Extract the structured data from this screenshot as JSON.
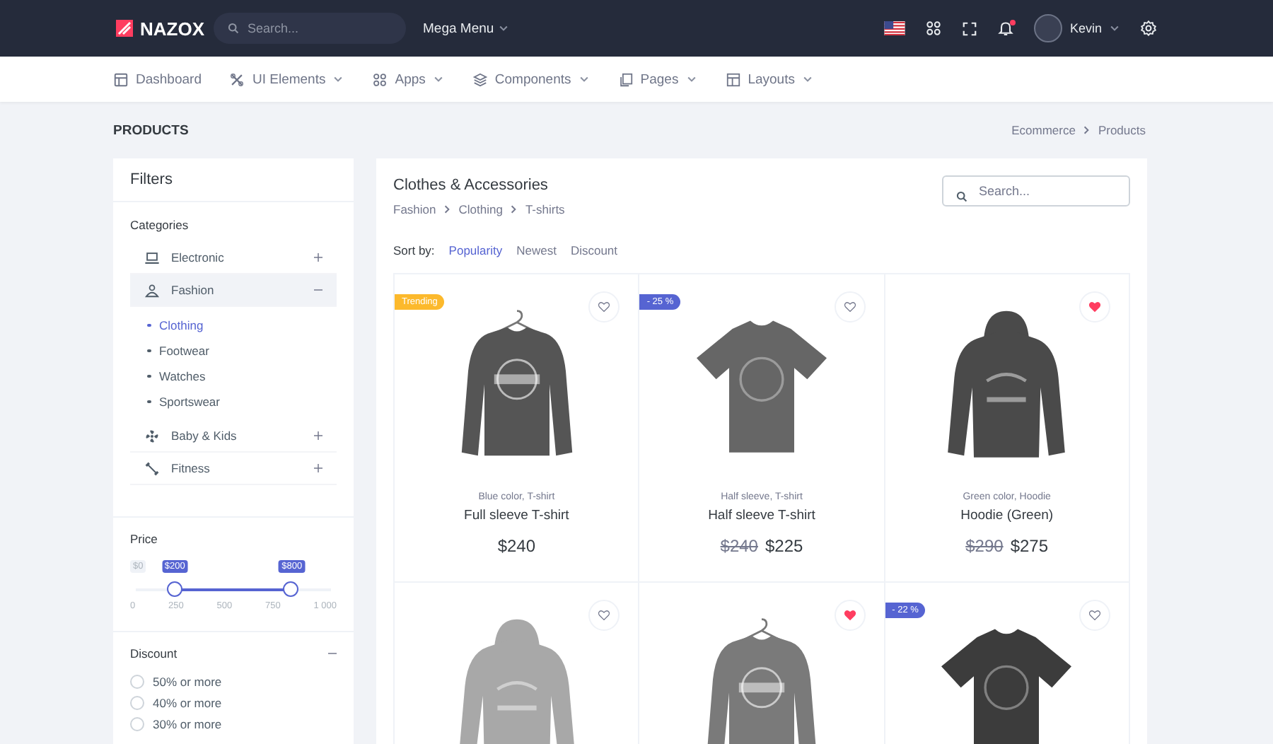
{
  "topbar": {
    "logo": "NAZOX",
    "search": {
      "placeholder": "Search..."
    },
    "mega_menu": "Mega Menu",
    "user": "Kevin"
  },
  "nav": [
    {
      "label": "Dashboard",
      "has_menu": false
    },
    {
      "label": "UI Elements",
      "has_menu": true
    },
    {
      "label": "Apps",
      "has_menu": true
    },
    {
      "label": "Components",
      "has_menu": true
    },
    {
      "label": "Pages",
      "has_menu": true
    },
    {
      "label": "Layouts",
      "has_menu": true
    }
  ],
  "page_title": "PRODUCTS",
  "breadcrumb": [
    "Ecommerce",
    "Products"
  ],
  "filters": {
    "title": "Filters",
    "categories_label": "Categories",
    "categories": [
      {
        "label": "Electronic",
        "expanded": false,
        "selected": false
      },
      {
        "label": "Fashion",
        "expanded": true,
        "selected": true,
        "children": [
          {
            "label": "Clothing",
            "selected": true
          },
          {
            "label": "Footwear",
            "selected": false
          },
          {
            "label": "Watches",
            "selected": false
          },
          {
            "label": "Sportswear",
            "selected": false
          }
        ]
      },
      {
        "label": "Baby & Kids",
        "expanded": false,
        "selected": false
      },
      {
        "label": "Fitness",
        "expanded": false,
        "selected": false
      }
    ],
    "price": {
      "label": "Price",
      "min_label": "$0",
      "thumbs": [
        {
          "label": "$200",
          "level": 0.2
        },
        {
          "label": "$800",
          "level": 0.8
        }
      ],
      "ticks": [
        "0",
        "250",
        "500",
        "750",
        "1 000"
      ]
    },
    "discount": {
      "label": "Discount",
      "expanded": true,
      "options": [
        {
          "label": "50% or more",
          "selected": false
        },
        {
          "label": "40% or more",
          "selected": false
        },
        {
          "label": "30% or more",
          "selected": false
        }
      ]
    }
  },
  "catalog": {
    "title": "Clothes & Accessories",
    "breadcrumb": [
      "Fashion",
      "Clothing",
      "T-shirts"
    ],
    "search": {
      "placeholder": "Search..."
    },
    "sort_label": "Sort by:",
    "sort_options": [
      {
        "label": "Popularity",
        "selected": true
      },
      {
        "label": "Newest",
        "selected": false
      },
      {
        "label": "Discount",
        "selected": false
      }
    ],
    "products": [
      {
        "image": {
          "kind": "sweatshirt"
        },
        "badge": {
          "kind": "trending",
          "text": "Trending"
        },
        "favorite": false,
        "subtitle": "Blue color, T-shirt",
        "name": "Full sleeve T-shirt",
        "price": "$240"
      },
      {
        "image": {
          "kind": "tshirt"
        },
        "badge": {
          "kind": "discount",
          "text": "- 25 %"
        },
        "favorite": false,
        "subtitle": "Half sleeve, T-shirt",
        "name": "Half sleeve T-shirt",
        "old_price": "$240",
        "price": "$225"
      },
      {
        "image": {
          "kind": "hoodie"
        },
        "favorite": true,
        "subtitle": "Green color, Hoodie",
        "name": "Hoodie (Green)",
        "old_price": "$290",
        "price": "$275"
      },
      {
        "image": {
          "kind": "hoodie"
        },
        "favorite": false
      },
      {
        "image": {
          "kind": "sweatshirt"
        },
        "favorite": true
      },
      {
        "image": {
          "kind": "tshirt"
        },
        "badge": {
          "kind": "discount",
          "text": "- 22 %"
        },
        "favorite": false
      }
    ]
  }
}
